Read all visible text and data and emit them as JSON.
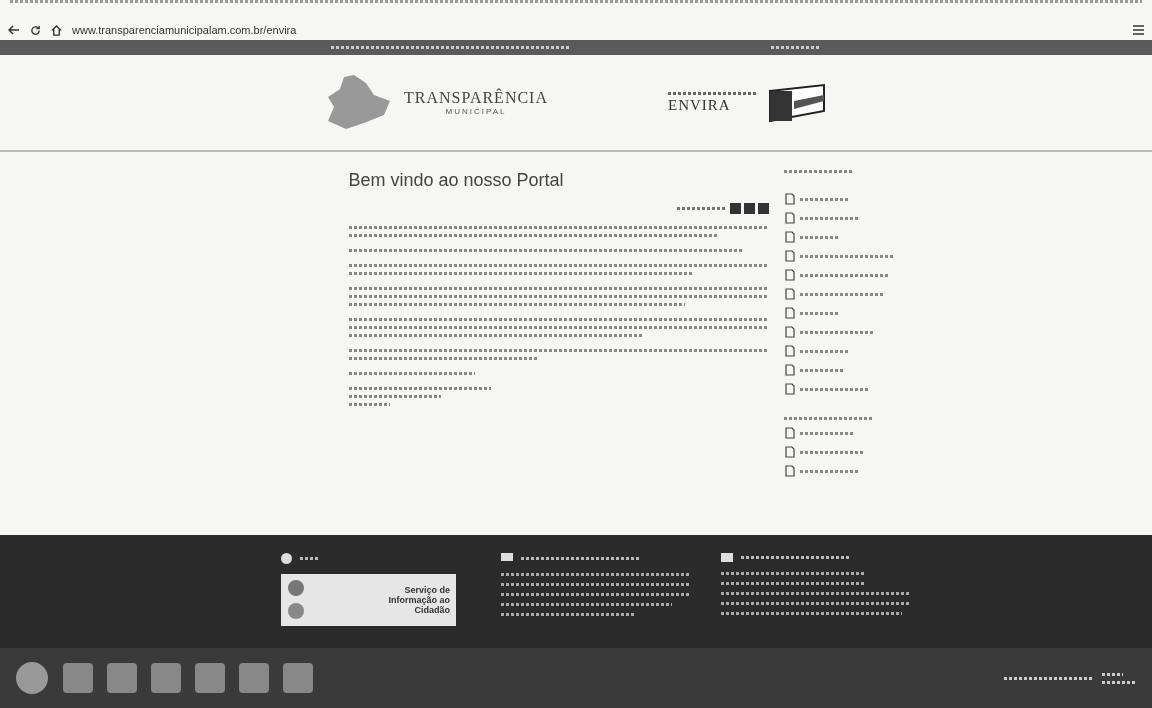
{
  "browser": {
    "url": "www.transparenciamunicipalam.com.br/envira"
  },
  "header": {
    "logo_title": "TRANSPARÊNCIA",
    "logo_subtitle": "MUNICIPAL",
    "city": "ENVIRA"
  },
  "content": {
    "heading": "Bem vindo ao nosso Portal"
  },
  "footer": {
    "banner": "Serviço de Informação ao Cidadão"
  }
}
